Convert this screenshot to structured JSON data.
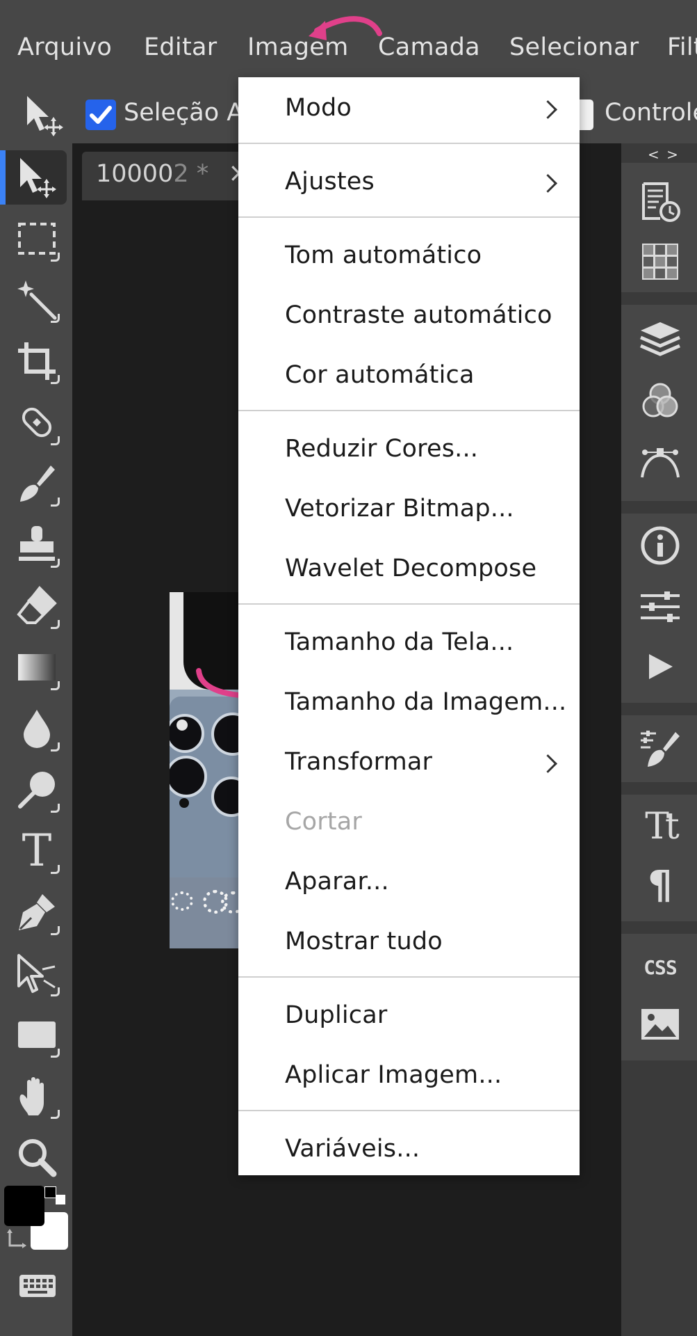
{
  "menubar": {
    "items": [
      "Arquivo",
      "Editar",
      "Imagem",
      "Camada",
      "Selecionar",
      "Filt"
    ]
  },
  "options": {
    "auto_select_label": "Seleção A",
    "auto_select_checked": true,
    "transform_controls_label": "Controle"
  },
  "document": {
    "tab_title_bright": "10000",
    "tab_title_dim": "2 *",
    "close_symbol": "×"
  },
  "right_panel": {
    "toggle_label": "< >",
    "css_label": "CSS"
  },
  "dropdown": {
    "items": [
      {
        "label": "Modo",
        "submenu": true
      },
      {
        "label": "Ajustes",
        "submenu": true
      },
      {
        "label": "Tom automático"
      },
      {
        "label": "Contraste automático"
      },
      {
        "label": "Cor automática"
      },
      {
        "label": "Reduzir Cores..."
      },
      {
        "label": "Vetorizar Bitmap..."
      },
      {
        "label": "Wavelet Decompose"
      },
      {
        "label": "Tamanho da Tela..."
      },
      {
        "label": "Tamanho da Imagem..."
      },
      {
        "label": "Transformar",
        "submenu": true
      },
      {
        "label": "Cortar",
        "disabled": true
      },
      {
        "label": "Aparar..."
      },
      {
        "label": "Mostrar tudo"
      },
      {
        "label": "Duplicar"
      },
      {
        "label": "Aplicar Imagem..."
      },
      {
        "label": "Variáveis..."
      }
    ]
  },
  "tools": [
    "move-tool",
    "marquee-tool",
    "magic-wand-tool",
    "crop-tool",
    "healing-tool",
    "brush-tool",
    "stamp-tool",
    "eraser-tool",
    "gradient-tool",
    "blur-tool",
    "dodge-tool",
    "type-tool",
    "pen-tool",
    "path-select-tool",
    "shape-tool",
    "hand-tool",
    "zoom-tool"
  ],
  "colors": {
    "accent": "#3b82f6",
    "annotation": "#e0408a",
    "foreground_swatch": "#000000",
    "background_swatch": "#ffffff"
  }
}
